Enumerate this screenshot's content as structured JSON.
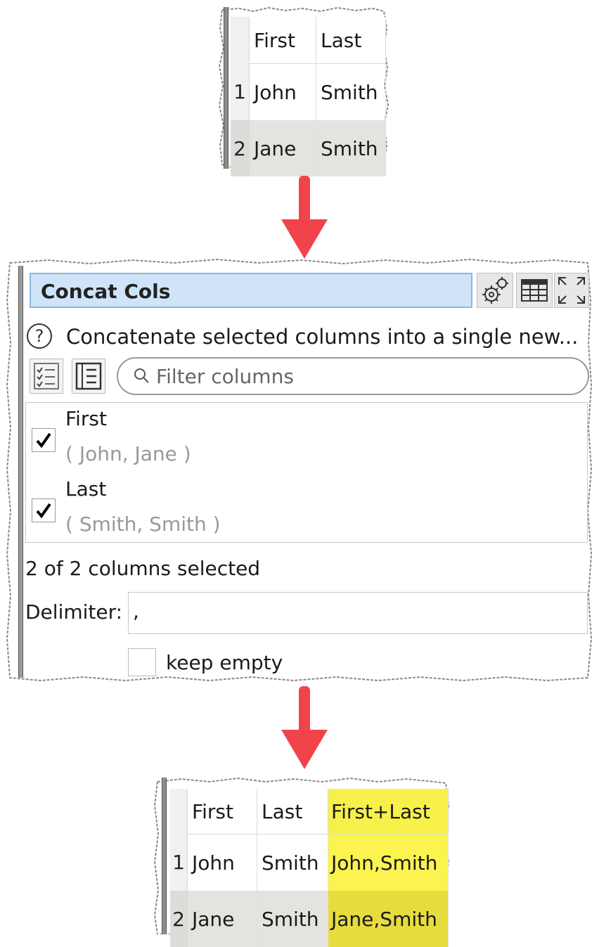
{
  "input_table": {
    "columns": [
      "First",
      "Last"
    ],
    "rows": [
      {
        "num": "1",
        "cells": [
          "John",
          "Smith"
        ]
      },
      {
        "num": "2",
        "cells": [
          "Jane",
          "Smith"
        ]
      }
    ]
  },
  "transform": {
    "title": "Concat Cols",
    "description": "Concatenate selected columns into a single new...",
    "filter_placeholder": "Filter columns",
    "columns": [
      {
        "name": "First",
        "values": "( John, Jane )",
        "checked": true
      },
      {
        "name": "Last",
        "values": "( Smith, Smith )",
        "checked": true
      }
    ],
    "selected_count": "2 of 2 columns selected",
    "delimiter_label": "Delimiter:",
    "delimiter_value": ",",
    "keep_empty_label": "keep empty",
    "keep_empty_checked": false
  },
  "output_table": {
    "columns": [
      "First",
      "Last",
      "First+Last"
    ],
    "rows": [
      {
        "num": "1",
        "cells": [
          "John",
          "Smith",
          "John,Smith"
        ]
      },
      {
        "num": "2",
        "cells": [
          "Jane",
          "Smith",
          "Jane,Smith"
        ]
      }
    ],
    "highlight_color": "#f7f04a"
  },
  "colors": {
    "arrow": "#f0444a",
    "title_bar": "#cfe4f9",
    "title_bar_border": "#8ab6e0"
  },
  "icons": [
    "settings-gear-icon",
    "table-view-icon",
    "maximize-icon",
    "help-icon",
    "select-all-icon",
    "list-view-icon",
    "search-icon",
    "checkmark-icon",
    "arrow-down-icon"
  ]
}
